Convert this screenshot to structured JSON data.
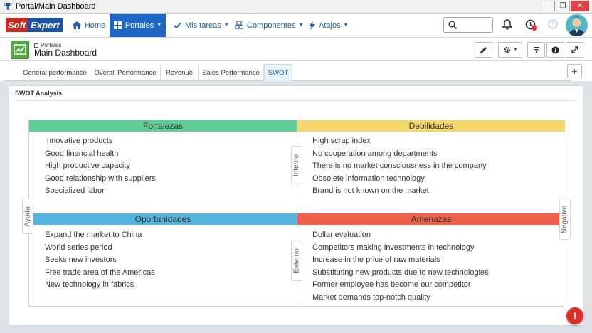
{
  "window": {
    "title": "Portal/Main Dashboard"
  },
  "brand": {
    "soft": "Soft",
    "expert": "Expert"
  },
  "nav": {
    "home": "Home",
    "portales": "Portales",
    "mis_tareas": "Mis tareas",
    "componentes": "Componentes",
    "atajos": "Atajos"
  },
  "search": {
    "placeholder": ""
  },
  "notifications": {
    "badge": "1"
  },
  "page": {
    "breadcrumb": "Portales",
    "title": "Main Dashboard"
  },
  "tabs": [
    "General performance",
    "Overall Performance",
    "Revenue",
    "Sales Performance",
    "SWOT"
  ],
  "panel": {
    "title": "SWOT Analysis"
  },
  "swot": {
    "fortalezas": {
      "title": "Fortalezas",
      "items": [
        "Innovative products",
        "Good financial health",
        "High productive capacity",
        "Good relationship with suppliers",
        "Specialized labor"
      ]
    },
    "debilidades": {
      "title": "Debilidades",
      "items": [
        "High scrap index",
        "No cooperation among departments",
        "There is no market consciousness in the company",
        "Obsolete information technology",
        "Brand is not known on the market"
      ]
    },
    "oportunidades": {
      "title": "Oportunidades",
      "items": [
        "Expand the market to China",
        "World series period",
        "Seeks new investors",
        "Free trade area of the Americas",
        "New technology in fabrics"
      ]
    },
    "amenazas": {
      "title": "Amenazas",
      "items": [
        "Dollar evaluation",
        "Competitors making investments in technology",
        "Increase in the price of raw materials",
        "Substituting new products due to new technologies",
        "Former employee has become our competitor",
        "Market demands top-notch quality"
      ]
    },
    "axis": {
      "interno": "Interno",
      "externo": "Externo",
      "ayuda": "Ayuda",
      "negativo": "Negativo"
    }
  },
  "colors": {
    "fortalezas": "#5ecd96",
    "debilidades": "#f5d86a",
    "oportunidades": "#55b4dd",
    "amenazas": "#ef6048",
    "nav_active": "#1f66c2"
  }
}
